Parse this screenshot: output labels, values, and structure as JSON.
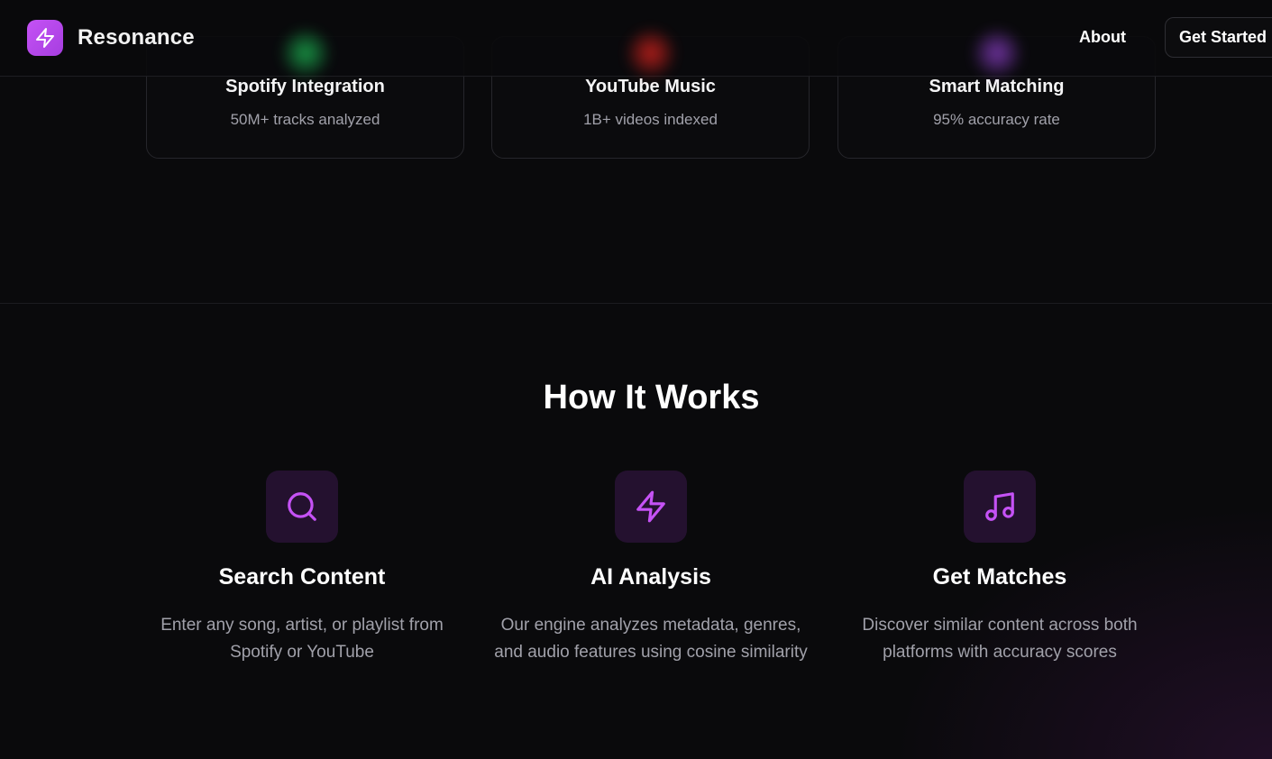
{
  "header": {
    "brand": "Resonance",
    "nav_about": "About",
    "cta": "Get Started"
  },
  "stats": [
    {
      "title": "Spotify Integration",
      "subtitle": "50M+ tracks analyzed",
      "glow_color": "#1db954"
    },
    {
      "title": "YouTube Music",
      "subtitle": "1B+ videos indexed",
      "glow_color": "#e0241e"
    },
    {
      "title": "Smart Matching",
      "subtitle": "95% accuracy rate",
      "glow_color": "#8b3fc7"
    }
  ],
  "how": {
    "title": "How It Works",
    "steps": [
      {
        "icon": "search-icon",
        "title": "Search Content",
        "desc": "Enter any song, artist, or playlist from Spotify or YouTube"
      },
      {
        "icon": "lightning-icon",
        "title": "AI Analysis",
        "desc": "Our engine analyzes metadata, genres, and audio features using cosine similarity"
      },
      {
        "icon": "music-note-icon",
        "title": "Get Matches",
        "desc": "Discover similar content across both platforms with accuracy scores"
      }
    ]
  },
  "colors": {
    "accent": "#c552f5",
    "icon_bg": "#24112f",
    "muted_text": "#a1a1aa"
  }
}
